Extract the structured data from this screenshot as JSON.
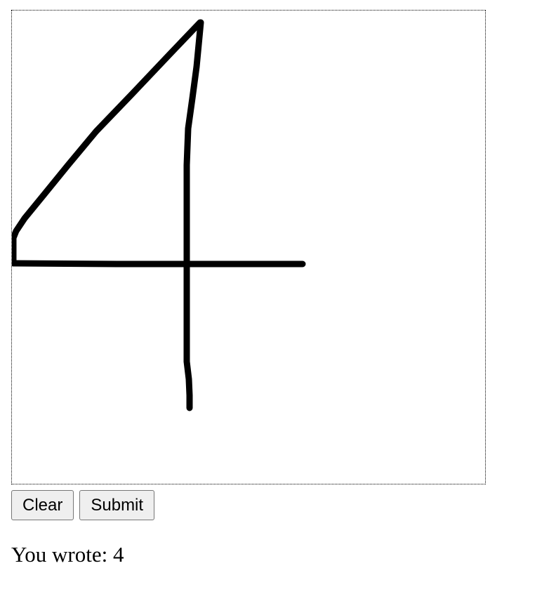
{
  "drawing": {
    "stroke_color": "#000000",
    "background_color": "#ffffff"
  },
  "controls": {
    "clear_label": "Clear",
    "submit_label": "Submit"
  },
  "result": {
    "text": "You wrote: 4"
  }
}
